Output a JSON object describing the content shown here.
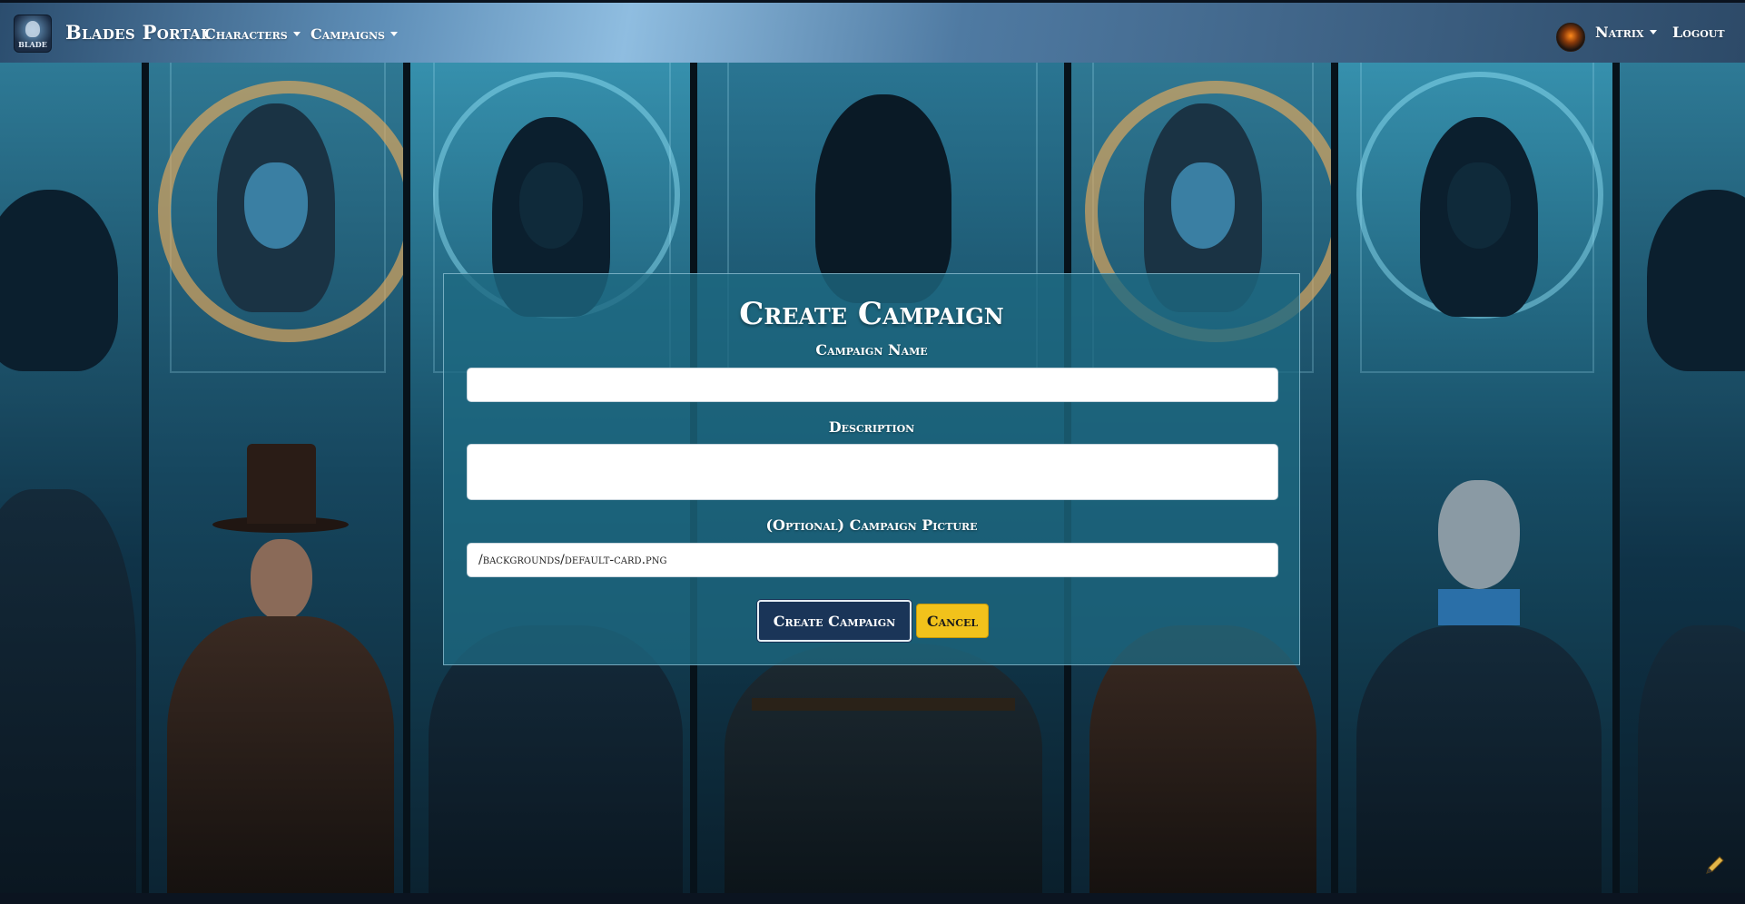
{
  "navbar": {
    "brand_logo_text": "BLADE",
    "brand_name": "Blades Portal",
    "menu": [
      {
        "label": "Characters"
      },
      {
        "label": "Campaigns"
      }
    ],
    "user_name": "Natrix",
    "logout_label": "Logout"
  },
  "form": {
    "title": "Create Campaign",
    "campaign_name_label": "Campaign Name",
    "campaign_name_value": "",
    "description_label": "Description",
    "description_value": "",
    "picture_label": "(Optional) Campaign Picture",
    "picture_value": "/backgrounds/default-card.png",
    "submit_label": "Create Campaign",
    "cancel_label": "Cancel"
  },
  "colors": {
    "card_bg": "#1e6982",
    "primary_button": "#1a3558",
    "cancel_button": "#f1c21b"
  },
  "icons": [
    "brand-logo",
    "chevron-down-icon",
    "user-avatar",
    "edit-pen-icon"
  ]
}
